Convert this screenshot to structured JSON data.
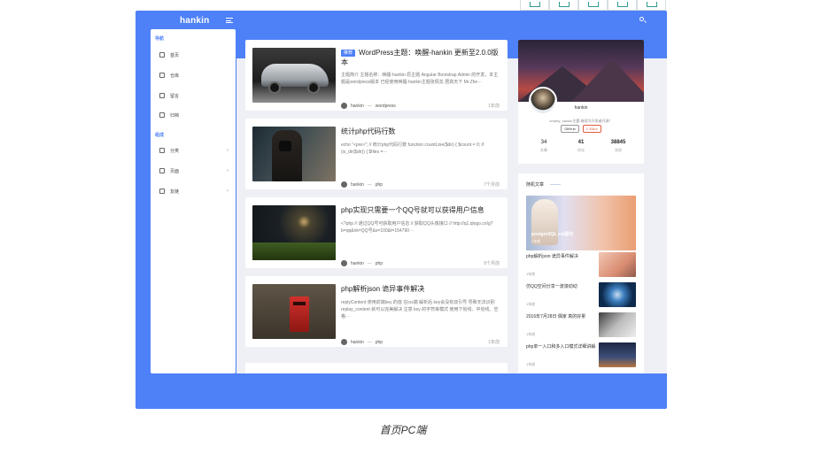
{
  "frame": {
    "brand": "hankin"
  },
  "sidebar": {
    "sections": [
      {
        "label": "导航",
        "items": [
          "首页",
          "仓库",
          "留言",
          "归档"
        ]
      },
      {
        "label": "组成",
        "items": [
          "分类",
          "页面",
          "友链"
        ]
      }
    ]
  },
  "posts": [
    {
      "tag": "推荐",
      "title": "WordPress主题：唤醒-hankin 更新至2.0.0版本",
      "excerpt": "主题简介 主题名称：唤醒-hankin 原主题 Angular Bootstrap Admin 的开发，本主题是wordpress版本 已经使用唤醒-hankin主题张佩龙 居高天下 Mr.Zhe···",
      "author": "hankin",
      "category": "wordpress",
      "time": "1年前"
    },
    {
      "tag": "",
      "title": "统计php代码行数",
      "excerpt": "echo \"<pre>\"; // 统计php代码行数 function countLine($dir) { $count = 0; if (is_dir($dir)) { $files =···",
      "author": "hankin",
      "category": "php",
      "time": "7个月前"
    },
    {
      "tag": "",
      "title": "php实现只需要一个QQ号就可以获得用户信息",
      "excerpt": "<?php // 通过QQ号可获取用户信息 // 获取QQ头像接口 // http://q1.qlogo.cn/g?b=qq&nk=QQ号&s=100&t=154790···",
      "author": "hankin",
      "category": "php",
      "time": "9个月前"
    },
    {
      "tag": "",
      "title": "php解析json 诡异事件解决",
      "excerpt": "replyContent 使用前端key 的值 在ios端 解析后 key会没有双引号 导致无法识别 replay_content 就可以完美解决 注意 key 的字符串模式 使用下划线、中划线、空格···",
      "author": "hankin",
      "category": "php",
      "time": "1年前"
    }
  ],
  "profile": {
    "name": "hankin",
    "bio": "smarty_hankin主题 继续为开发者开源！",
    "badge_github": "GitHub",
    "badge_count": "1.35k/s",
    "stats": [
      {
        "num": "34",
        "label": "文章"
      },
      {
        "num": "41",
        "label": "评论"
      },
      {
        "num": "38845",
        "label": "浏览"
      }
    ]
  },
  "random": {
    "heading": "随机文章",
    "feature": {
      "title": "postgreSQL sql语句",
      "date": "1年前"
    },
    "items": [
      {
        "title": "php解析json 诡异事件解决",
        "date": "1年前"
      },
      {
        "title": "仿QQ空间分享一波滚动动",
        "date": "1年前"
      },
      {
        "title": "2016年7月28日 偶家 真的好累",
        "date": "1年前"
      },
      {
        "title": "php单一入口和多入口模式详细讲解",
        "date": "1年前"
      }
    ]
  },
  "caption": "首页PC端"
}
